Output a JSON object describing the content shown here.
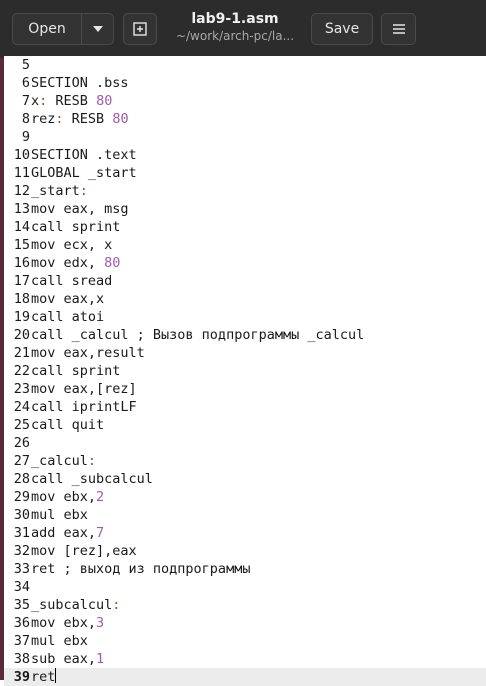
{
  "header": {
    "open_label": "Open",
    "title": "lab9-1.asm",
    "subtitle": "~/work/arch-pc/la...",
    "save_label": "Save"
  },
  "colors": {
    "header_bg": "#2c2c2c",
    "number_color": "#a15ca8",
    "label_colon_color": "#a0522d",
    "current_line_bg": "#ececec"
  },
  "icons": {
    "open_dropdown": "chevron-down-icon",
    "new_tab": "new-tab-icon",
    "menu": "hamburger-icon"
  },
  "editor": {
    "current_line": 39,
    "lines": [
      {
        "n": "5",
        "parts": []
      },
      {
        "n": "6",
        "parts": [
          {
            "t": "SECTION .bss"
          }
        ]
      },
      {
        "n": "7",
        "parts": [
          {
            "t": "x"
          },
          {
            "t": ":",
            "c": "colon"
          },
          {
            "t": " RESB "
          },
          {
            "t": "80",
            "c": "num"
          }
        ]
      },
      {
        "n": "8",
        "parts": [
          {
            "t": "rez"
          },
          {
            "t": ":",
            "c": "colon"
          },
          {
            "t": " RESB "
          },
          {
            "t": "80",
            "c": "num"
          }
        ]
      },
      {
        "n": "9",
        "parts": []
      },
      {
        "n": "10",
        "parts": [
          {
            "t": "SECTION .text"
          }
        ]
      },
      {
        "n": "11",
        "parts": [
          {
            "t": "GLOBAL _start"
          }
        ]
      },
      {
        "n": "12",
        "parts": [
          {
            "t": "_start"
          },
          {
            "t": ":",
            "c": "colon"
          }
        ]
      },
      {
        "n": "13",
        "parts": [
          {
            "t": "mov eax, msg"
          }
        ]
      },
      {
        "n": "14",
        "parts": [
          {
            "t": "call sprint"
          }
        ]
      },
      {
        "n": "15",
        "parts": [
          {
            "t": "mov ecx, x"
          }
        ]
      },
      {
        "n": "16",
        "parts": [
          {
            "t": "mov edx, "
          },
          {
            "t": "80",
            "c": "num"
          }
        ]
      },
      {
        "n": "17",
        "parts": [
          {
            "t": "call sread"
          }
        ]
      },
      {
        "n": "18",
        "parts": [
          {
            "t": "mov eax,x"
          }
        ]
      },
      {
        "n": "19",
        "parts": [
          {
            "t": "call atoi"
          }
        ]
      },
      {
        "n": "20",
        "parts": [
          {
            "t": "call _calcul ; Вызов подпрограммы _calcul"
          }
        ]
      },
      {
        "n": "21",
        "parts": [
          {
            "t": "mov eax,result"
          }
        ]
      },
      {
        "n": "22",
        "parts": [
          {
            "t": "call sprint"
          }
        ]
      },
      {
        "n": "23",
        "parts": [
          {
            "t": "mov eax,[rez]"
          }
        ]
      },
      {
        "n": "24",
        "parts": [
          {
            "t": "call iprintLF"
          }
        ]
      },
      {
        "n": "25",
        "parts": [
          {
            "t": "call quit"
          }
        ]
      },
      {
        "n": "26",
        "parts": []
      },
      {
        "n": "27",
        "parts": [
          {
            "t": "_calcul"
          },
          {
            "t": ":",
            "c": "colon"
          }
        ]
      },
      {
        "n": "28",
        "parts": [
          {
            "t": "call _subcalcul"
          }
        ]
      },
      {
        "n": "29",
        "parts": [
          {
            "t": "mov ebx,"
          },
          {
            "t": "2",
            "c": "num"
          }
        ]
      },
      {
        "n": "30",
        "parts": [
          {
            "t": "mul ebx"
          }
        ]
      },
      {
        "n": "31",
        "parts": [
          {
            "t": "add eax,"
          },
          {
            "t": "7",
            "c": "num"
          }
        ]
      },
      {
        "n": "32",
        "parts": [
          {
            "t": "mov [rez],eax"
          }
        ]
      },
      {
        "n": "33",
        "parts": [
          {
            "t": "ret ; выход из подпрограммы"
          }
        ]
      },
      {
        "n": "34",
        "parts": []
      },
      {
        "n": "35",
        "parts": [
          {
            "t": "_subcalcul"
          },
          {
            "t": ":",
            "c": "colon"
          }
        ]
      },
      {
        "n": "36",
        "parts": [
          {
            "t": "mov ebx,"
          },
          {
            "t": "3",
            "c": "num"
          }
        ]
      },
      {
        "n": "37",
        "parts": [
          {
            "t": "mul ebx"
          }
        ]
      },
      {
        "n": "38",
        "parts": [
          {
            "t": "sub eax,"
          },
          {
            "t": "1",
            "c": "num"
          }
        ]
      },
      {
        "n": "39",
        "parts": [
          {
            "t": "ret"
          }
        ]
      }
    ]
  }
}
